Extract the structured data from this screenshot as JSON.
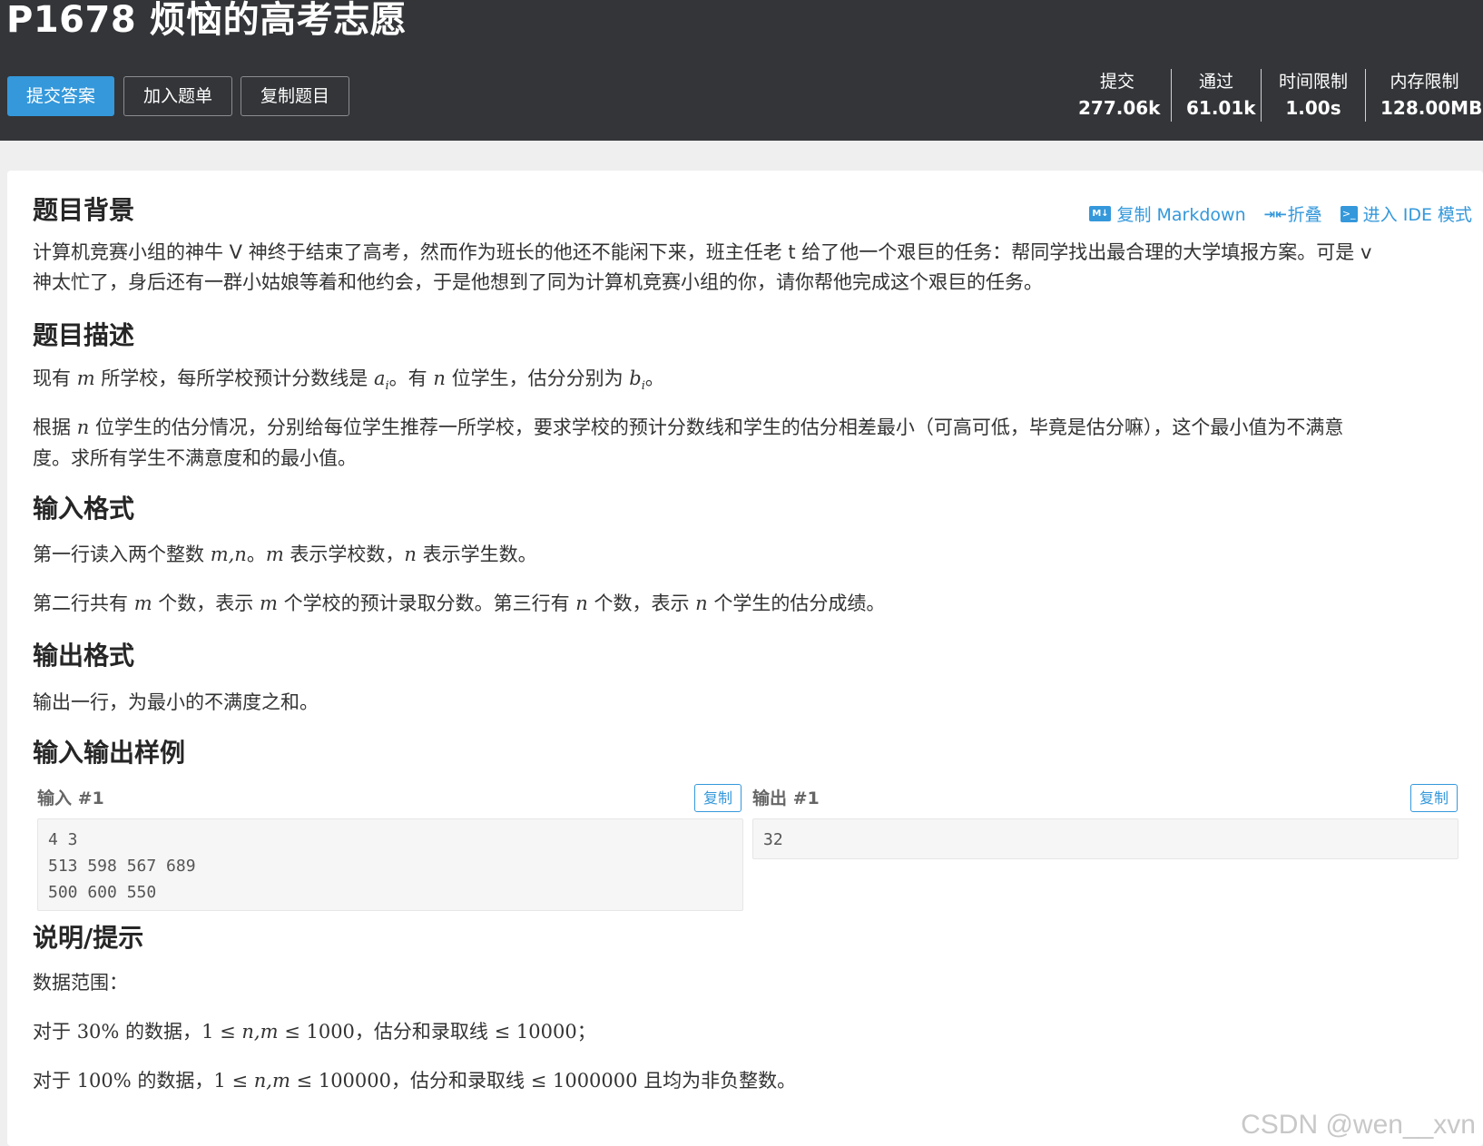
{
  "header": {
    "title": "P1678 烦恼的高考志愿",
    "buttons": {
      "submit": "提交答案",
      "add_to_list": "加入题单",
      "copy_problem": "复制题目"
    },
    "stats": {
      "submit_label": "提交",
      "submit_value": "277.06k",
      "pass_label": "通过",
      "pass_value": "61.01k",
      "time_label": "时间限制",
      "time_value": "1.00s",
      "memory_label": "内存限制",
      "memory_value": "128.00MB"
    }
  },
  "toolbar": {
    "copy_markdown_icon": "M↓",
    "copy_markdown": "复制 Markdown",
    "fold_icon": "⇥⇤",
    "fold": "折叠",
    "ide_icon": ">_",
    "ide_mode": "进入 IDE 模式"
  },
  "background": {
    "title": "题目背景",
    "line1": "计算机竞赛小组的神牛 V 神终于结束了高考，然而作为班长的他还不能闲下来，班主任老 t 给了他一个艰巨的任务：帮同学找出最合理的大学填报方案。可是 v",
    "line2": "神太忙了，身后还有一群小姑娘等着和他约会，于是他想到了同为计算机竞赛小组的你，请你帮他完成这个艰巨的任务。"
  },
  "description": {
    "title": "题目描述",
    "p1": {
      "a": "现有 ",
      "m": "m",
      "b": " 所学校，每所学校预计分数线是 ",
      "ai": "a",
      "ai_sub": "i",
      "c": "。有 ",
      "n": "n",
      "d": " 位学生，估分分别为 ",
      "bi": "b",
      "bi_sub": "i",
      "e": "。"
    },
    "p2": {
      "a": "根据 ",
      "n": "n",
      "b": " 位学生的估分情况，分别给每位学生推荐一所学校，要求学校的预计分数线和学生的估分相差最小（可高可低，毕竟是估分嘛），这个最小值为不满意",
      "line2": "度。求所有学生不满意度和的最小值。"
    }
  },
  "input_format": {
    "title": "输入格式",
    "p1": {
      "a": "第一行读入两个整数 ",
      "mn": "m,n",
      "b": "。",
      "m": "m",
      "c": " 表示学校数，",
      "n": "n",
      "d": " 表示学生数。"
    },
    "p2": {
      "a": "第二行共有 ",
      "m1": "m",
      "b": " 个数，表示 ",
      "m2": "m",
      "c": " 个学校的预计录取分数。第三行有 ",
      "n1": "n",
      "d": " 个数，表示 ",
      "n2": "n",
      "e": " 个学生的估分成绩。"
    }
  },
  "output_format": {
    "title": "输出格式",
    "text": "输出一行，为最小的不满度之和。"
  },
  "samples": {
    "title": "输入输出样例",
    "input_label": "输入 #1",
    "output_label": "输出 #1",
    "copy_label": "复制",
    "input_lines": [
      "4 3",
      "513 598 567 689",
      "500 600 550"
    ],
    "output_lines": [
      "32"
    ]
  },
  "hint": {
    "title": "说明/提示",
    "range_label": "数据范围：",
    "p1": {
      "a": "对于 ",
      "pct": "30%",
      "b": " 的数据，",
      "one": "1",
      "le1": " ≤ ",
      "nm": "n,m",
      "le2": " ≤ ",
      "lim": "1000",
      "c": "，估分和录取线 ",
      "le3": "≤ ",
      "lim2": "10000",
      "d": "；"
    },
    "p2": {
      "a": "对于 ",
      "pct": "100%",
      "b": " 的数据，",
      "one": "1",
      "le1": " ≤ ",
      "nm": "n,m",
      "le2": " ≤ ",
      "lim": "100000",
      "c": "，估分和录取线 ",
      "le3": "≤ ",
      "lim2": "1000000",
      "d": " 且均为非负整数。"
    }
  },
  "watermark": "CSDN @wen__xvn"
}
